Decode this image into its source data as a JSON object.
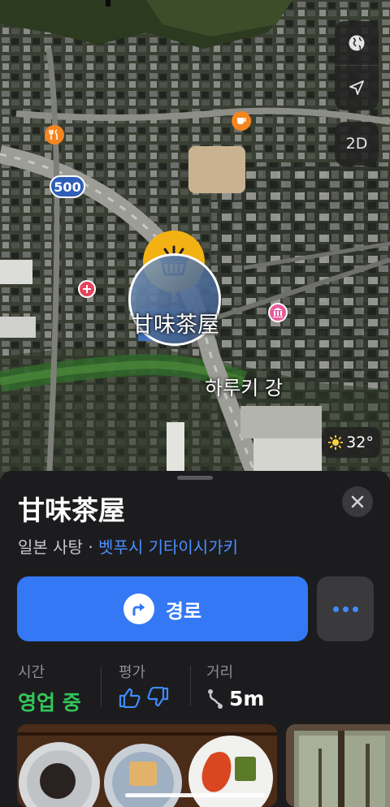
{
  "map": {
    "road_shield": "500",
    "river_label": "하루키 강",
    "selected_pin_label": "甘味茶屋",
    "controls": {
      "globe_icon": "globe-icon",
      "location_icon": "location-arrow-icon",
      "view_mode": "2D"
    },
    "weather": {
      "icon": "sun-icon",
      "temperature": "32°"
    },
    "pois": [
      "restaurant-icon",
      "cafe-icon",
      "hospital-icon",
      "museum-icon",
      "shopping-basket-icon"
    ]
  },
  "place": {
    "name": "甘味茶屋",
    "category": "일본 사탕",
    "separator": "·",
    "location": "벳푸시 기타이시가키"
  },
  "actions": {
    "route_label": "경로",
    "route_icon": "directions-turn-icon",
    "more_icon": "more-icon"
  },
  "info": {
    "hours_label": "시간",
    "hours_value": "영업 중",
    "rating_label": "평가",
    "distance_label": "거리",
    "distance_value": "5m"
  },
  "colors": {
    "accent_blue": "#3478f6",
    "open_green": "#32c759",
    "sheet_bg": "#1c1c1e",
    "pin_yellow": "#f2b213",
    "river_label": "#ffffff"
  }
}
